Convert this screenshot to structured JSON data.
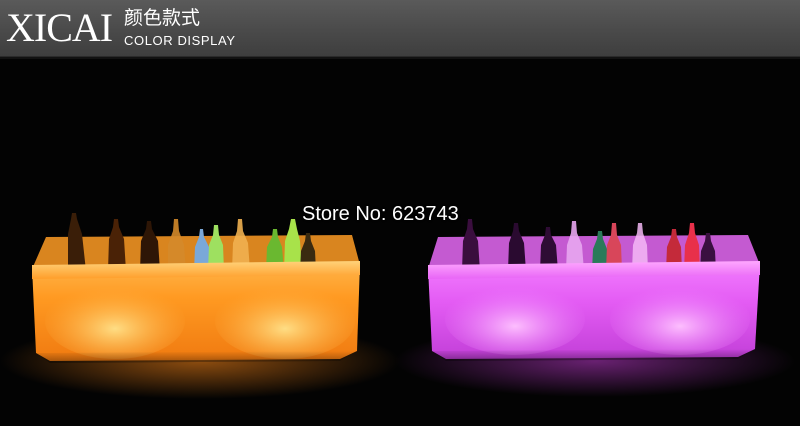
{
  "header": {
    "brand": "XICAI",
    "title_cn": "颜色款式",
    "title_en": "COLOR DISPLAY"
  },
  "watermark": {
    "text": "Store No: 623743"
  },
  "colors": {
    "header_bg": "#4a4a4a",
    "orange_glow": "#ff9a2a",
    "purple_glow": "#e055f0"
  }
}
